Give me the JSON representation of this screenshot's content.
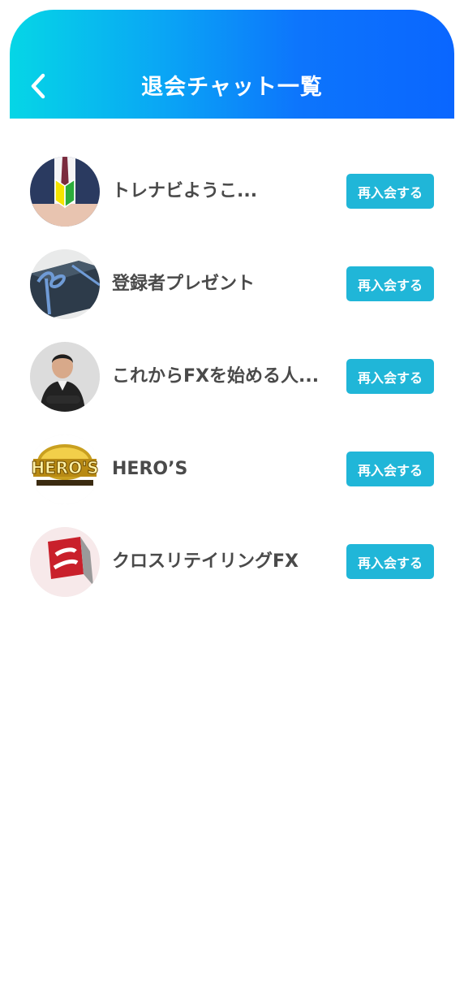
{
  "header": {
    "title": "退会チャット一覧",
    "back_icon": "chevron-left-icon",
    "gradient": [
      "#05d6e6",
      "#0a66ff"
    ]
  },
  "chats": [
    {
      "name": "トレナビようこ...",
      "button": "再入会する",
      "avatar": "beginner-mark-suit-avatar"
    },
    {
      "name": "登録者プレゼント",
      "button": "再入会する",
      "avatar": "gift-box-avatar"
    },
    {
      "name": "これからFXを始める人...",
      "button": "再入会する",
      "avatar": "man-portrait-avatar"
    },
    {
      "name": "HERO’S",
      "button": "再入会する",
      "avatar": "heros-gold-logo-avatar",
      "logo_text": "HERO'S"
    },
    {
      "name": "クロスリテイリングFX",
      "button": "再入会する",
      "avatar": "cross-retailing-logo-avatar"
    }
  ],
  "colors": {
    "button_bg": "#20b6d8",
    "name_text": "#4a4a4a"
  }
}
